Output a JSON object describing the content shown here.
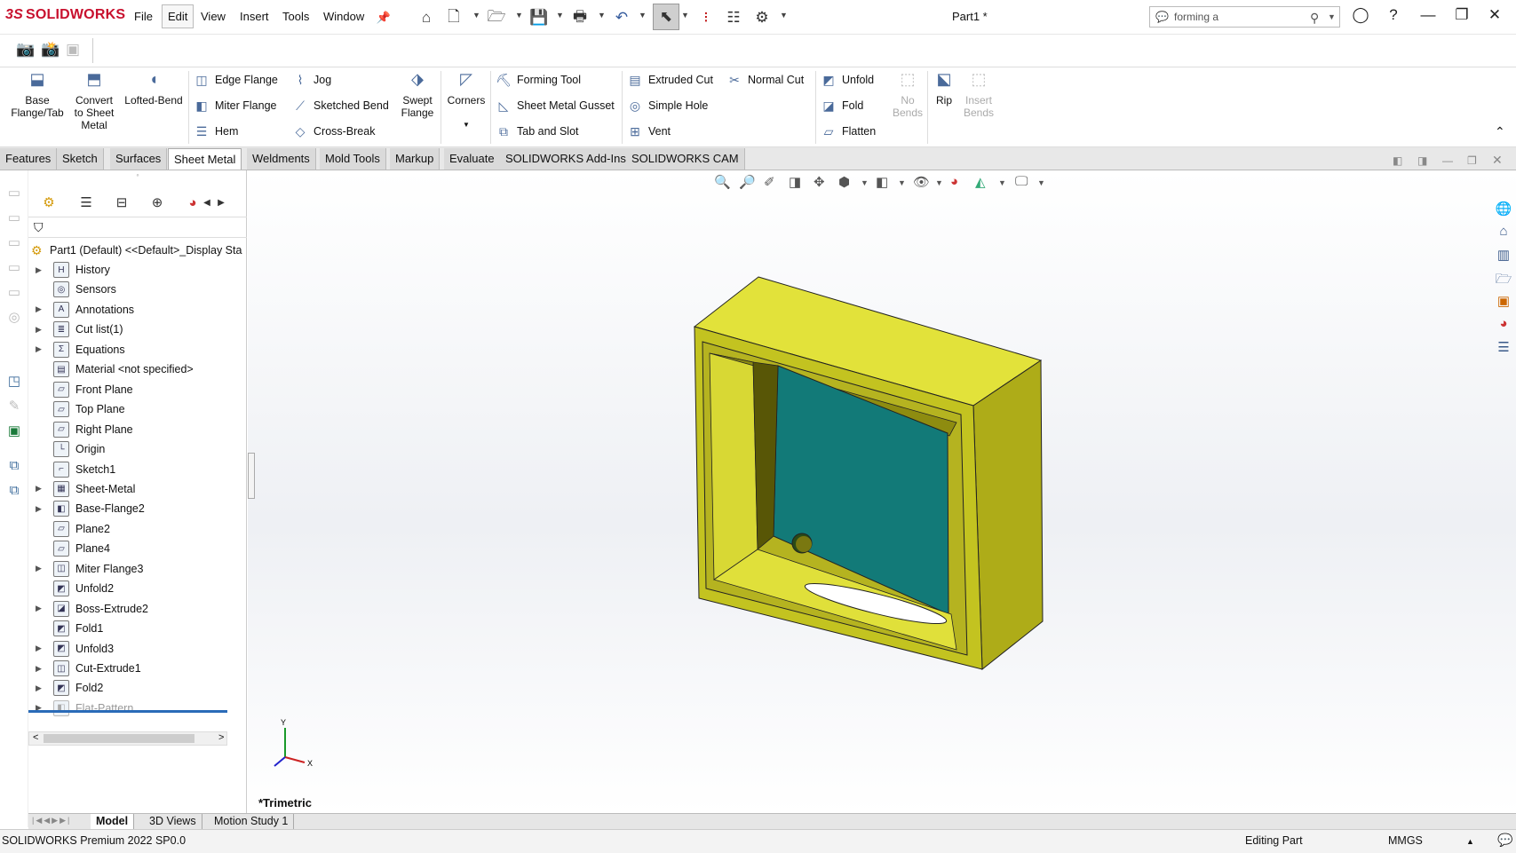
{
  "app": {
    "brand": "SOLIDWORKS",
    "doc_title": "Part1 *"
  },
  "menu": [
    "File",
    "Edit",
    "View",
    "Insert",
    "Tools",
    "Window"
  ],
  "search": {
    "value": "forming a"
  },
  "command_manager": {
    "base_flange": "Base\nFlange/Tab",
    "convert": "Convert\nto Sheet\nMetal",
    "lofted_bend": "Lofted-Bend",
    "edge_flange": "Edge Flange",
    "miter_flange": "Miter Flange",
    "hem": "Hem",
    "jog": "Jog",
    "sketched_bend": "Sketched Bend",
    "cross_break": "Cross-Break",
    "swept_flange": "Swept\nFlange",
    "corners": "Corners",
    "forming_tool": "Forming Tool",
    "gusset": "Sheet Metal Gusset",
    "tab_slot": "Tab and Slot",
    "extruded_cut": "Extruded Cut",
    "simple_hole": "Simple Hole",
    "vent": "Vent",
    "normal_cut": "Normal Cut",
    "unfold": "Unfold",
    "fold": "Fold",
    "flatten": "Flatten",
    "no_bends": "No\nBends",
    "rip": "Rip",
    "insert_bends": "Insert\nBends"
  },
  "tabs": [
    "Features",
    "Sketch",
    "Surfaces",
    "Sheet Metal",
    "Weldments",
    "Mold Tools",
    "Markup",
    "Evaluate",
    "SOLIDWORKS Add-Ins",
    "SOLIDWORKS CAM"
  ],
  "tree": {
    "root": "Part1 (Default) <<Default>_Display Sta",
    "items": [
      {
        "label": "History",
        "arrow": true,
        "icon": "H"
      },
      {
        "label": "Sensors",
        "arrow": false,
        "icon": "◎"
      },
      {
        "label": "Annotations",
        "arrow": true,
        "icon": "A"
      },
      {
        "label": "Cut list(1)",
        "arrow": true,
        "icon": "≣"
      },
      {
        "label": "Equations",
        "arrow": true,
        "icon": "Σ"
      },
      {
        "label": "Material <not specified>",
        "arrow": false,
        "icon": "▤"
      },
      {
        "label": "Front Plane",
        "arrow": false,
        "icon": "▱"
      },
      {
        "label": "Top Plane",
        "arrow": false,
        "icon": "▱"
      },
      {
        "label": "Right Plane",
        "arrow": false,
        "icon": "▱"
      },
      {
        "label": "Origin",
        "arrow": false,
        "icon": "└"
      },
      {
        "label": "Sketch1",
        "arrow": false,
        "icon": "⌐"
      },
      {
        "label": "Sheet-Metal",
        "arrow": true,
        "icon": "▦"
      },
      {
        "label": "Base-Flange2",
        "arrow": true,
        "icon": "◧"
      },
      {
        "label": "Plane2",
        "arrow": false,
        "icon": "▱"
      },
      {
        "label": "Plane4",
        "arrow": false,
        "icon": "▱"
      },
      {
        "label": "Miter Flange3",
        "arrow": true,
        "icon": "◫"
      },
      {
        "label": "Unfold2",
        "arrow": false,
        "icon": "◩"
      },
      {
        "label": "Boss-Extrude2",
        "arrow": true,
        "icon": "◪"
      },
      {
        "label": "Fold1",
        "arrow": false,
        "icon": "◩"
      },
      {
        "label": "Unfold3",
        "arrow": true,
        "icon": "◩"
      },
      {
        "label": "Cut-Extrude1",
        "arrow": true,
        "icon": "◫"
      },
      {
        "label": "Fold2",
        "arrow": true,
        "icon": "◩"
      },
      {
        "label": "Flat-Pattern",
        "arrow": true,
        "icon": "◧",
        "dim": true
      }
    ]
  },
  "viewport": {
    "view_label": "*Trimetric",
    "axis_x": "X",
    "axis_y": "Y"
  },
  "bottom_tabs": [
    "Model",
    "3D Views",
    "Motion Study 1"
  ],
  "status": {
    "product": "SOLIDWORKS Premium 2022 SP0.0",
    "mode": "Editing Part",
    "units": "MMGS"
  },
  "colors": {
    "accent": "#c8102e",
    "part_yellow": "#e6e62a",
    "panel_teal": "#127a78"
  }
}
